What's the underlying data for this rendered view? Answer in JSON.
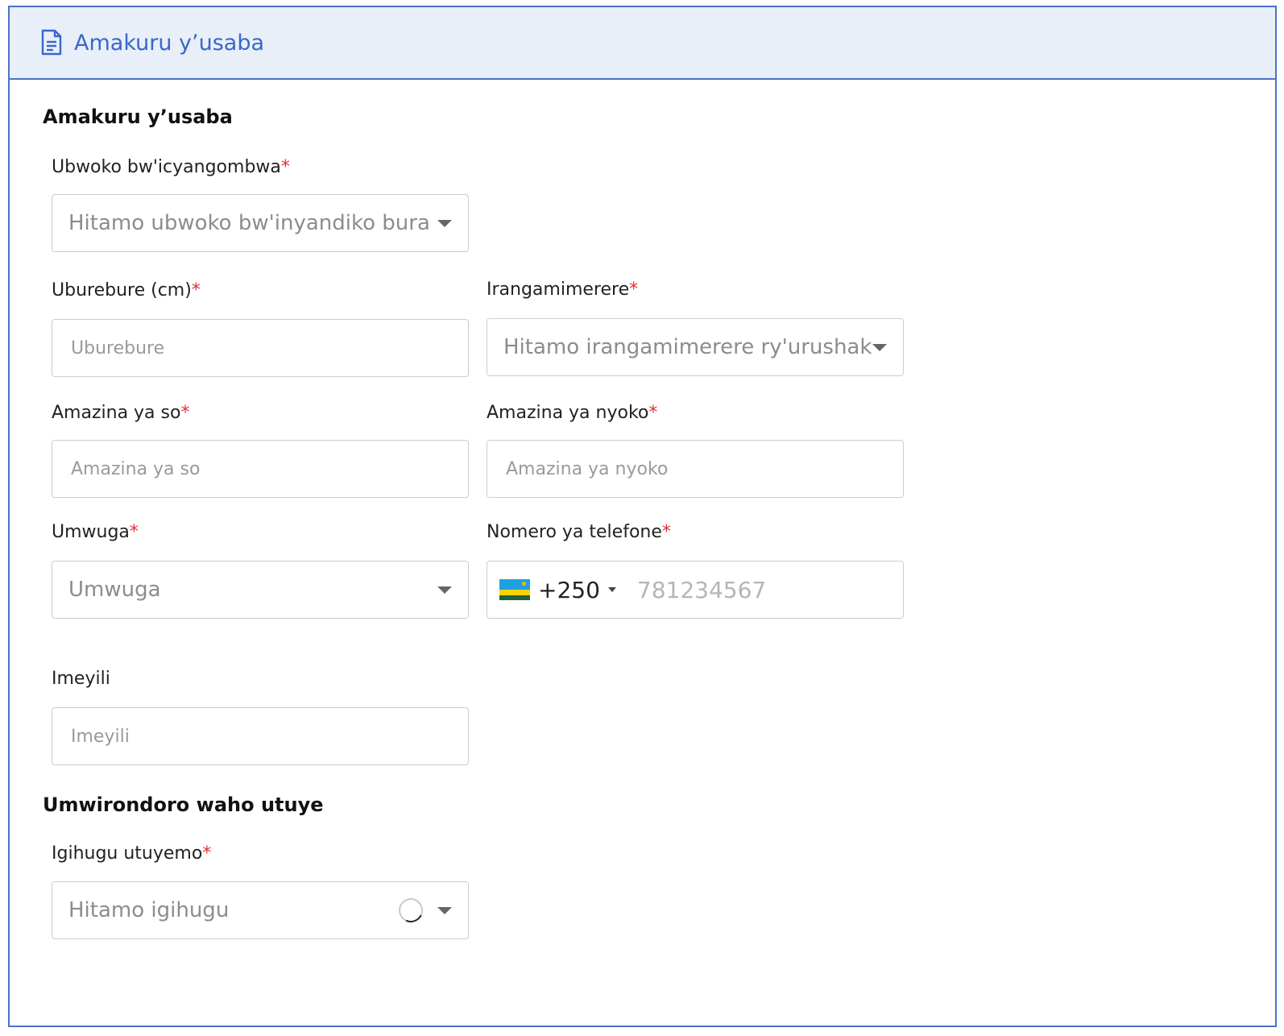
{
  "header": {
    "title": "Amakuru y’usaba",
    "icon": "document-icon"
  },
  "sections": {
    "applicant": "Amakuru y’usaba",
    "residence": "Umwirondoro waho utuye"
  },
  "required_marker": "*",
  "fields": {
    "permit_type": {
      "label": "Ubwoko bw'icyangombwa",
      "value": "Hitamo ubwoko bw'inyandiko bura"
    },
    "height": {
      "label": "Uburebure (cm)",
      "placeholder": "Uburebure"
    },
    "eye_color": {
      "label": "Irangamimerere",
      "value": "Hitamo irangamimerere ry'urushak"
    },
    "father_name": {
      "label": "Amazina ya so",
      "placeholder": "Amazina ya so"
    },
    "mother_name": {
      "label": "Amazina ya nyoko",
      "placeholder": "Amazina ya nyoko"
    },
    "occupation": {
      "label": "Umwuga",
      "value": "Umwuga"
    },
    "phone": {
      "label": "Nomero ya telefone",
      "dial_code": "+250",
      "placeholder": "781234567",
      "country_flag": "rwanda-flag-icon"
    },
    "email": {
      "label": "Imeyili",
      "placeholder": "Imeyili"
    },
    "country": {
      "label": "Igihugu utuyemo",
      "value": "Hitamo igihugu"
    }
  },
  "colors": {
    "accent": "#4a72c9",
    "header_bg": "#e8eff9",
    "required": "#e0303a"
  }
}
